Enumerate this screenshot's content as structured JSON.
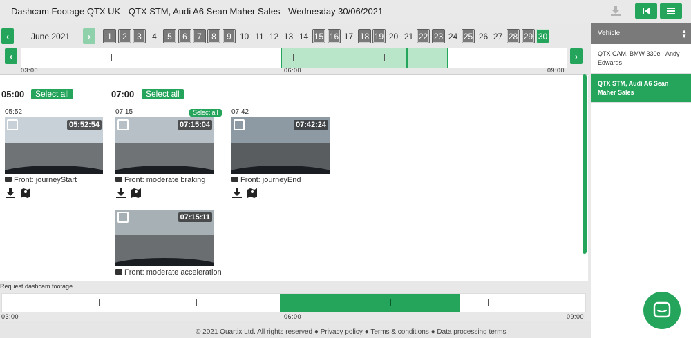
{
  "header": {
    "app_title": "Dashcam Footage QTX UK",
    "vehicle": "QTX STM, Audi A6 Sean Maher Sales",
    "date": "Wednesday 30/06/2021"
  },
  "calendar": {
    "month_label": "June 2021",
    "days": [
      {
        "n": "1",
        "has": true
      },
      {
        "n": "2",
        "has": true
      },
      {
        "n": "3",
        "has": true
      },
      {
        "n": "4",
        "has": false
      },
      {
        "n": "5",
        "has": true
      },
      {
        "n": "6",
        "has": true
      },
      {
        "n": "7",
        "has": true
      },
      {
        "n": "8",
        "has": true
      },
      {
        "n": "9",
        "has": true
      },
      {
        "n": "10",
        "has": false
      },
      {
        "n": "11",
        "has": false
      },
      {
        "n": "12",
        "has": false
      },
      {
        "n": "13",
        "has": false
      },
      {
        "n": "14",
        "has": false
      },
      {
        "n": "15",
        "has": true
      },
      {
        "n": "16",
        "has": true
      },
      {
        "n": "17",
        "has": false
      },
      {
        "n": "18",
        "has": true
      },
      {
        "n": "19",
        "has": true
      },
      {
        "n": "20",
        "has": false
      },
      {
        "n": "21",
        "has": false
      },
      {
        "n": "22",
        "has": true
      },
      {
        "n": "23",
        "has": true
      },
      {
        "n": "24",
        "has": false
      },
      {
        "n": "25",
        "has": true
      },
      {
        "n": "26",
        "has": false
      },
      {
        "n": "27",
        "has": false
      },
      {
        "n": "28",
        "has": true
      },
      {
        "n": "29",
        "has": true
      },
      {
        "n": "30",
        "has": true,
        "selected": true
      }
    ]
  },
  "timeline": {
    "labels": [
      "03:00",
      "06:00",
      "09:00"
    ]
  },
  "groups": [
    {
      "hour": "05:00",
      "select_all": "Select all"
    },
    {
      "hour": "07:00",
      "select_all": "Select all",
      "sub_select_all": "Select all"
    }
  ],
  "clips": [
    {
      "time": "05:52",
      "stamp": "05:52:54",
      "caption": "Front: journeyStart",
      "sky": "#c9d1d8",
      "road": "#6f7376"
    },
    {
      "time": "07:15",
      "stamp": "07:15:04",
      "caption": "Front: moderate braking",
      "sky": "#b7c0c6",
      "road": "#707376"
    },
    {
      "time": "07:42",
      "stamp": "07:42:24",
      "caption": "Front: journeyEnd",
      "sky": "#8e9aa3",
      "road": "#5a5d60"
    },
    {
      "time": "",
      "stamp": "07:15:11",
      "caption": "Front: moderate acceleration",
      "sky": "#a7b1b5",
      "road": "#6a6e70"
    }
  ],
  "request": {
    "label": "Request dashcam footage",
    "labels": [
      "03:00",
      "06:00",
      "09:00"
    ]
  },
  "footer": {
    "copyright": "© 2021 Quartix Ltd. All rights reserved",
    "privacy": "Privacy policy",
    "terms": "Terms & conditions",
    "data_terms": "Data processing terms"
  },
  "sidebar": {
    "header": "Vehicle",
    "items": [
      {
        "label": "QTX CAM, BMW 330e - Andy Edwards"
      },
      {
        "label": "QTX STM, Audi A6 Sean Maher Sales"
      }
    ]
  },
  "colors": {
    "accent": "#25a55b",
    "accent_light": "#b9e5c9",
    "header_gray": "#7a7a7a"
  },
  "icons": {
    "download": "download-icon",
    "map": "map-icon",
    "camera": "camera-icon",
    "chat": "chat-icon"
  }
}
